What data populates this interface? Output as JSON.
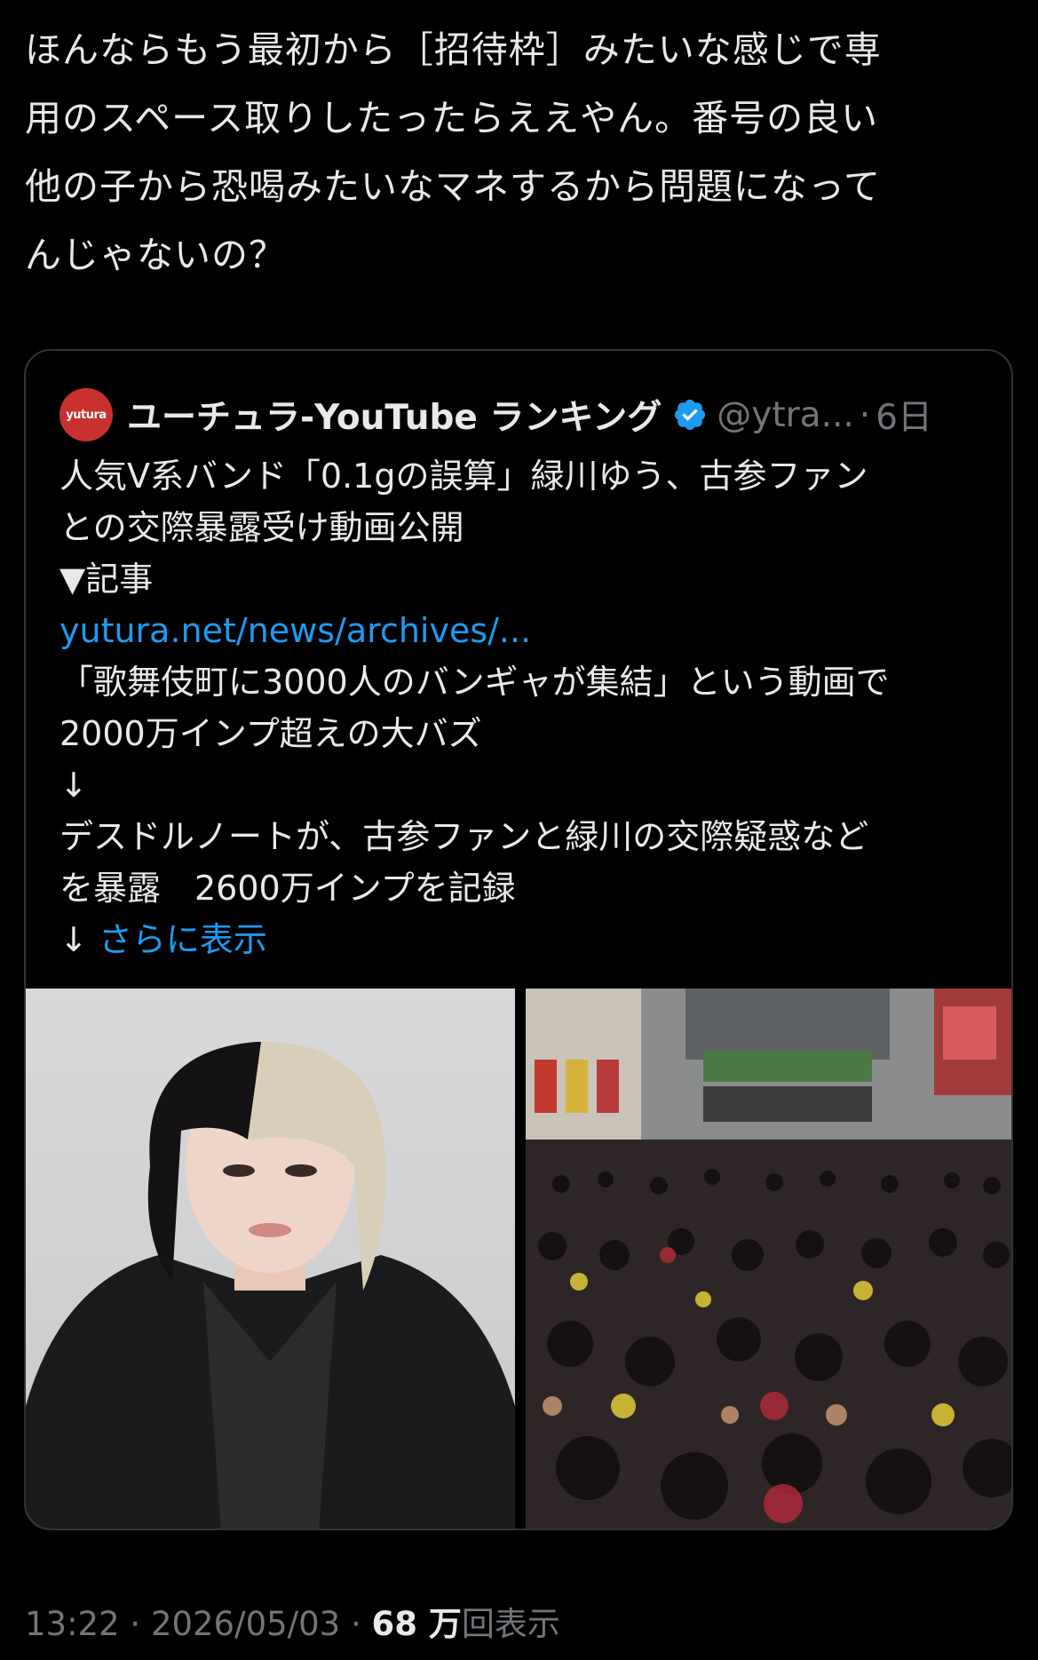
{
  "tweet": {
    "text_lines": [
      "ほんならもう最初から［招待枠］みたいな感じで専",
      "用のスペース取りしたったらええやん。番号の良い",
      "他の子から恐喝みたいなマネするから問題になって",
      "んじゃないの？"
    ],
    "time": "13:22",
    "separator": "·",
    "date": "2026/05/03",
    "views_count": "68 万",
    "views_label": "回表示"
  },
  "quote": {
    "avatar_text": "yutura",
    "display_name": "ユーチュラ-YouTube ランキング",
    "verified_icon": "verified-badge-icon",
    "handle": "@ytra...",
    "dot": "·",
    "age": "6日",
    "body_lines": [
      "人気V系バンド「0.1gの誤算」緑川ゆう、古参ファン",
      "との交際暴露受け動画公開",
      "▼記事"
    ],
    "link_text": "yutura.net/news/archives/...",
    "body_lines_2": [
      "「歌舞伎町に3000人のバンギャが集結」という動画で",
      "2000万インプ超えの大バズ",
      "↓",
      "デスドルノートが、古参ファンと緑川の交際疑惑など",
      "を暴露　2600万インプを記録"
    ],
    "arrow": "↓ ",
    "show_more": "さらに表示"
  },
  "colors": {
    "background": "#000000",
    "text": "#e7e9ea",
    "muted": "#71767b",
    "link": "#1d9bf0",
    "border": "#2f3336",
    "avatar": "#c8312d"
  }
}
